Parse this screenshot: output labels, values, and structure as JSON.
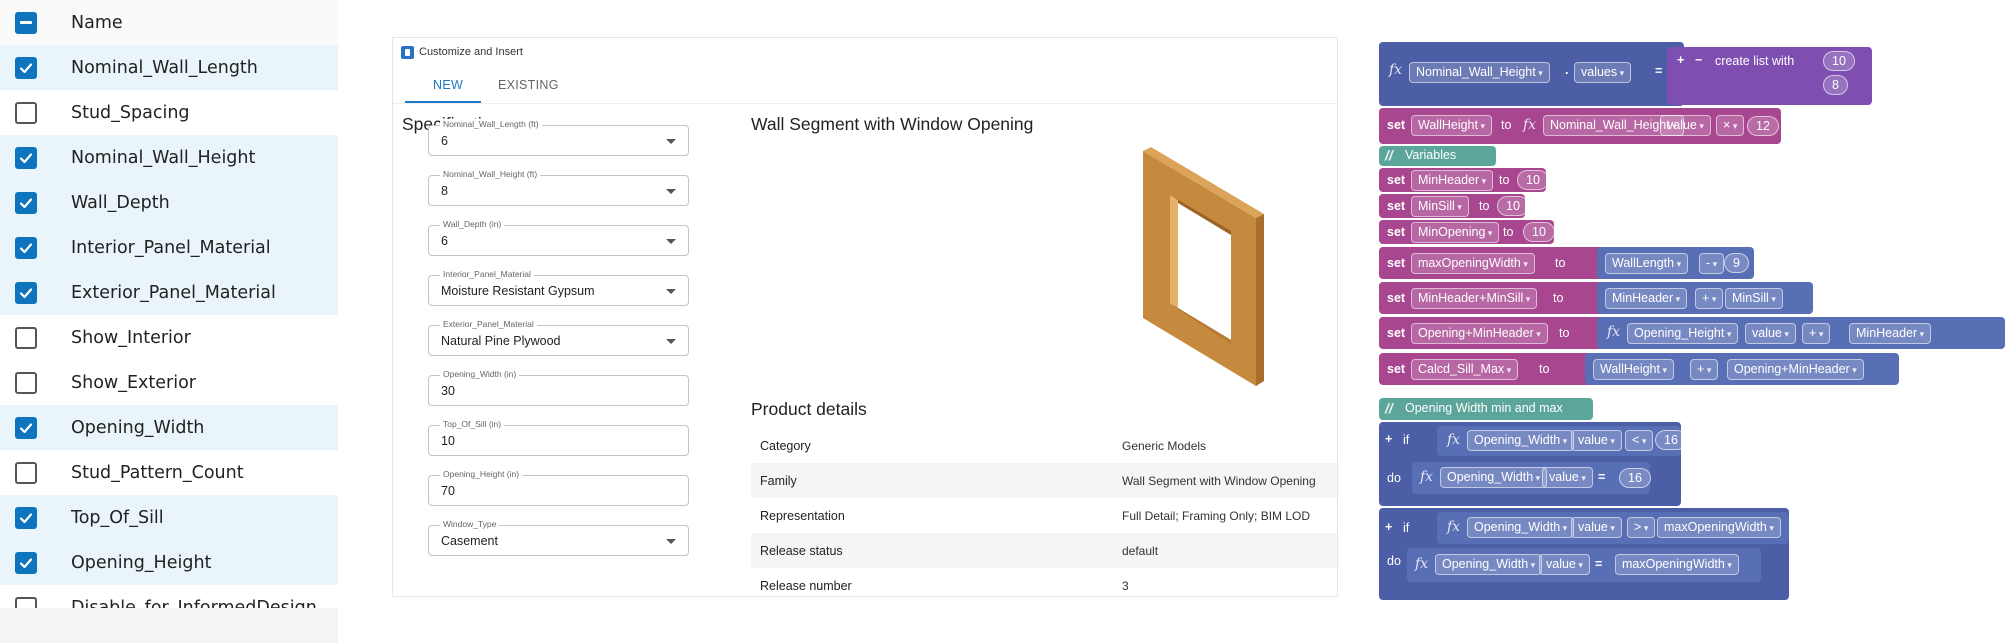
{
  "param_list": {
    "header_label": "Name",
    "items": [
      {
        "label": "Nominal_Wall_Length",
        "checked": true
      },
      {
        "label": "Stud_Spacing",
        "checked": false
      },
      {
        "label": "Nominal_Wall_Height",
        "checked": true
      },
      {
        "label": "Wall_Depth",
        "checked": true
      },
      {
        "label": "Interior_Panel_Material",
        "checked": true
      },
      {
        "label": "Exterior_Panel_Material",
        "checked": true
      },
      {
        "label": "Show_Interior",
        "checked": false
      },
      {
        "label": "Show_Exterior",
        "checked": false
      },
      {
        "label": "Opening_Width",
        "checked": true
      },
      {
        "label": "Stud_Pattern_Count",
        "checked": false
      },
      {
        "label": "Top_Of_Sill",
        "checked": true
      },
      {
        "label": "Opening_Height",
        "checked": true
      },
      {
        "label": "Disable_for_InformedDesign",
        "checked": false
      }
    ]
  },
  "dialog": {
    "title": "Customize and Insert",
    "tabs": [
      "NEW",
      "EXISTING"
    ],
    "specifications_heading": "Specifications",
    "fields": [
      {
        "label": "Nominal_Wall_Length (ft)",
        "value": "6",
        "dropdown": true
      },
      {
        "label": "Nominal_Wall_Height (ft)",
        "value": "8",
        "dropdown": true
      },
      {
        "label": "Wall_Depth (in)",
        "value": "6",
        "dropdown": true
      },
      {
        "label": "Interior_Panel_Material",
        "value": "Moisture Resistant Gypsum",
        "dropdown": true
      },
      {
        "label": "Exterior_Panel_Material",
        "value": "Natural Pine Plywood",
        "dropdown": true
      },
      {
        "label": "Opening_Width (in)",
        "value": "30",
        "dropdown": false
      },
      {
        "label": "Top_Of_Sill (in)",
        "value": "10",
        "dropdown": false
      },
      {
        "label": "Opening_Height (in)",
        "value": "70",
        "dropdown": false
      },
      {
        "label": "Window_Type",
        "value": "Casement",
        "dropdown": true
      }
    ],
    "preview_title": "Wall Segment with Window Opening",
    "details_heading": "Product details",
    "details": [
      {
        "key": "Category",
        "value": "Generic Models"
      },
      {
        "key": "Family",
        "value": "Wall Segment with Window Opening"
      },
      {
        "key": "Representation",
        "value": "Full Detail; Framing Only; BIM LOD"
      },
      {
        "key": "Release status",
        "value": "default"
      },
      {
        "key": "Release number",
        "value": "3"
      }
    ]
  },
  "blocks": {
    "b1": {
      "fx": "fx",
      "var": "Nominal_Wall_Height",
      "prop": "values",
      "eq": "=",
      "plus": "+",
      "minus": "−",
      "create": "create list with",
      "v1": "10",
      "v2": "8"
    },
    "b2": {
      "set": "set",
      "var": "WallHeight",
      "to": "to",
      "fx": "fx",
      "param": "Nominal_Wall_Height",
      "prop": "value",
      "op": "×",
      "num": "12"
    },
    "b3": {
      "comment": "Variables"
    },
    "b4": {
      "set": "set",
      "var": "MinHeader",
      "to": "to",
      "num": "10"
    },
    "b5": {
      "set": "set",
      "var": "MinSill",
      "to": "to",
      "num": "10"
    },
    "b6": {
      "set": "set",
      "var": "MinOpening",
      "to": "to",
      "num": "10"
    },
    "b7": {
      "set": "set",
      "var": "maxOpeningWidth",
      "to": "to",
      "a": "WallLength",
      "op": "-",
      "num": "9"
    },
    "b8": {
      "set": "set",
      "var": "MinHeader+MinSill",
      "to": "to",
      "a": "MinHeader",
      "op": "+",
      "b": "MinSill"
    },
    "b9": {
      "set": "set",
      "var": "Opening+MinHeader",
      "to": "to",
      "fx": "fx",
      "param": "Opening_Height",
      "prop": "value",
      "op": "+",
      "b": "MinHeader"
    },
    "b10": {
      "set": "set",
      "var": "Calcd_Sill_Max",
      "to": "to",
      "a": "WallHeight",
      "op": "+",
      "b": "Opening+MinHeader"
    },
    "b11": {
      "comment": "Opening Width min and max"
    },
    "b12": {
      "plus": "+",
      "if": "if",
      "fx": "fx",
      "param": "Opening_Width",
      "prop": "value",
      "op": "<",
      "num": "16"
    },
    "b13": {
      "do": "do",
      "fx": "fx",
      "param": "Opening_Width",
      "prop": "value",
      "eq": "=",
      "num": "16"
    },
    "b14": {
      "plus": "+",
      "if": "if",
      "fx": "fx",
      "param": "Opening_Width",
      "prop": "value",
      "op": ">",
      "b": "maxOpeningWidth"
    },
    "b15": {
      "do": "do",
      "fx": "fx",
      "param": "Opening_Width",
      "prop": "value",
      "eq": "=",
      "b": "maxOpeningWidth"
    }
  }
}
